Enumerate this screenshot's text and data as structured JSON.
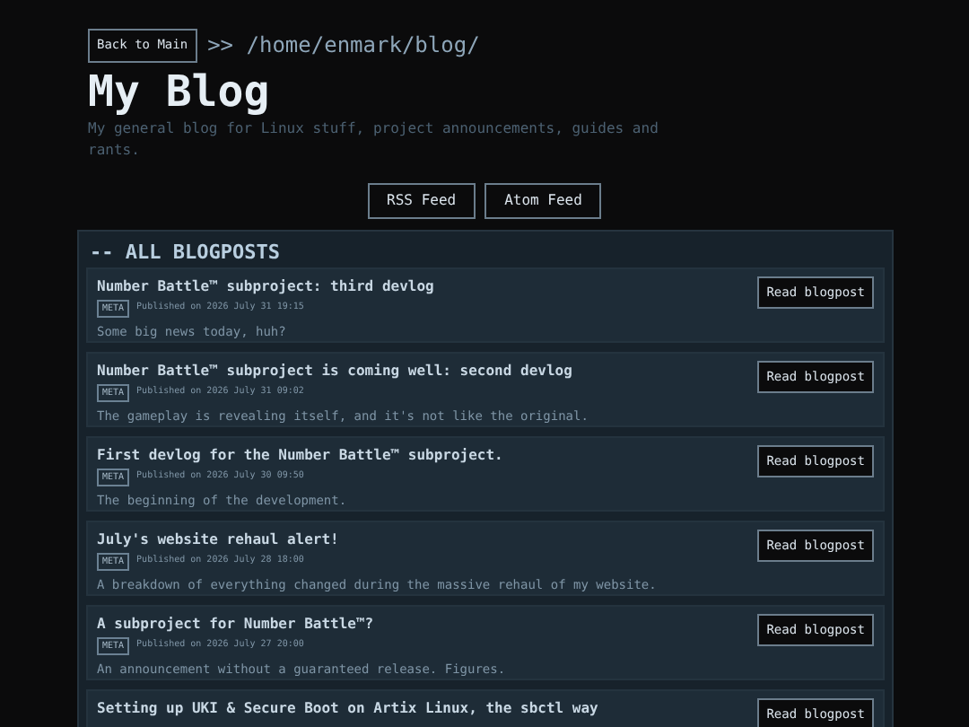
{
  "nav": {
    "back_button": "Back to Main",
    "path": ">> /home/enmark/blog/"
  },
  "title": "My Blog",
  "description": "My general blog for Linux stuff, project announcements, guides and rants.",
  "feeds": [
    "RSS Feed",
    "Atom Feed"
  ],
  "section": {
    "heading": "-- ALL BLOGPOSTS",
    "posts": [
      {
        "title": "Number Battle™ subproject: third devlog",
        "tag": "META",
        "published": "Published on 2026 July 31 19:15",
        "excerpt": "Some big news today, huh?",
        "button": "Read blogpost"
      },
      {
        "title": "Number Battle™ subproject is coming well: second devlog",
        "tag": "META",
        "published": "Published on 2026 July 31 09:02",
        "excerpt": "The gameplay is revealing itself, and it's not like the original.",
        "button": "Read blogpost"
      },
      {
        "title": "First devlog for the Number Battle™ subproject.",
        "tag": "META",
        "published": "Published on 2026 July 30 09:50",
        "excerpt": "The beginning of the development.",
        "button": "Read blogpost"
      },
      {
        "title": "July's website rehaul alert!",
        "tag": "META",
        "published": "Published on 2026 July 28 18:00",
        "excerpt": "A breakdown of everything changed during the massive rehaul of my website.",
        "button": "Read blogpost"
      },
      {
        "title": "A subproject for Number Battle™?",
        "tag": "META",
        "published": "Published on 2026 July 27 20:00",
        "excerpt": "An announcement without a guaranteed release. Figures.",
        "button": "Read blogpost"
      },
      {
        "title": "Setting up UKI & Secure Boot on Artix Linux, the sbctl way",
        "button": "Read blogpost"
      }
    ]
  }
}
